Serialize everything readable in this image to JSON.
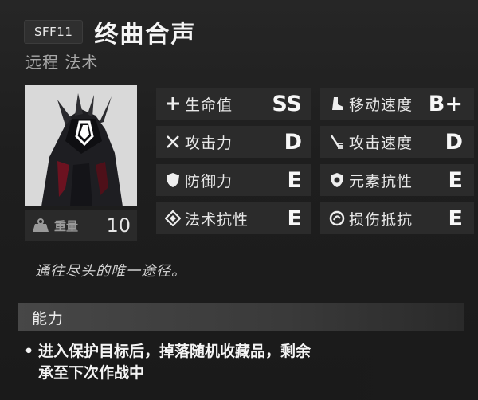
{
  "header": {
    "code": "SFF11",
    "title": "终曲合声",
    "subtitle": "远程 法术"
  },
  "portrait": {
    "icon": "character-portrait"
  },
  "weight": {
    "label": "重量",
    "value": "10",
    "icon": "weight-icon"
  },
  "stats": [
    {
      "label": "生命值",
      "grade": "SS",
      "icon": "plus-icon"
    },
    {
      "label": "移动速度",
      "grade": "B+",
      "icon": "boot-icon"
    },
    {
      "label": "攻击力",
      "grade": "D",
      "icon": "crossed-swords-icon"
    },
    {
      "label": "攻击速度",
      "grade": "D",
      "icon": "fast-sword-icon"
    },
    {
      "label": "防御力",
      "grade": "E",
      "icon": "shield-icon"
    },
    {
      "label": "元素抗性",
      "grade": "E",
      "icon": "element-shield-icon"
    },
    {
      "label": "法术抗性",
      "grade": "E",
      "icon": "diamond-icon"
    },
    {
      "label": "损伤抵抗",
      "grade": "E",
      "icon": "ring-icon"
    }
  ],
  "quote": "通往尽头的唯一途径。",
  "ability": {
    "title": "能力",
    "bullet": "•",
    "line1": "进入保护目标后，掉落随机收藏品，剩余",
    "line2": "承至下次作战中"
  }
}
